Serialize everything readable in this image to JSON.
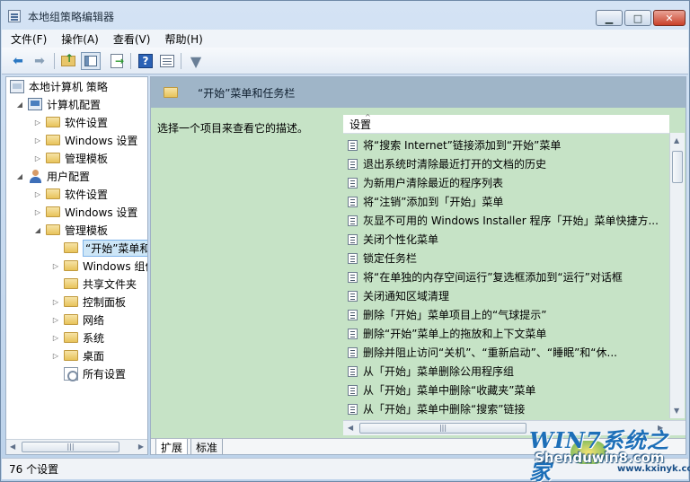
{
  "window": {
    "title": "本地组策略编辑器",
    "controls": {
      "minimize": "▁",
      "maximize": "□",
      "close": "✕"
    }
  },
  "menu": [
    "文件(F)",
    "操作(A)",
    "查看(V)",
    "帮助(H)"
  ],
  "toolbar": {
    "icons": [
      "back-arrow-icon",
      "forward-arrow-icon",
      "up-folder-icon",
      "show-hide-tree-icon",
      "export-list-icon",
      "help-icon",
      "properties-icon",
      "filter-icon"
    ],
    "back": "⬅",
    "forward": "➡",
    "help": "?",
    "filter": "▼"
  },
  "tree": {
    "root": "本地计算机 策略",
    "computer_config": "计算机配置",
    "cc_software": "软件设置",
    "cc_windows": "Windows 设置",
    "cc_admin": "管理模板",
    "user_config": "用户配置",
    "uc_software": "软件设置",
    "uc_windows": "Windows 设置",
    "uc_admin": "管理模板",
    "start_menu": "“开始”菜单和任务栏",
    "windows_components": "Windows 组件",
    "shared_folders": "共享文件夹",
    "control_panel": "控制面板",
    "network": "网络",
    "system": "系统",
    "desktop": "桌面",
    "all_settings": "所有设置",
    "scroll_thumb": "|||"
  },
  "right": {
    "header_title": "“开始”菜单和任务栏",
    "description": "选择一个项目来查看它的描述。",
    "column_header": "设置",
    "settings": [
      "将“搜索 Internet”链接添加到“开始”菜单",
      "退出系统时清除最近打开的文档的历史",
      "为新用户清除最近的程序列表",
      "将“注销”添加到「开始」菜单",
      "灰显不可用的 Windows Installer 程序「开始」菜单快捷方...",
      "关闭个性化菜单",
      "锁定任务栏",
      "将“在单独的内存空间运行”复选框添加到“运行”对话框",
      "关闭通知区域清理",
      "删除「开始」菜单项目上的“气球提示”",
      "删除“开始”菜单上的拖放和上下文菜单",
      "删除并阻止访问“关机”、“重新启动”、“睡眠”和“休...",
      "从「开始」菜单删除公用程序组",
      "从「开始」菜单中删除“收藏夹”菜单",
      "从「开始」菜单中删除“搜索”链接"
    ],
    "hscroll_thumb": "|||"
  },
  "tabs": [
    "扩展",
    "标准"
  ],
  "status": "76 个设置",
  "watermark": {
    "main": "WIN7系统之家",
    "sub": "Shenduwin8.com",
    "url": "www.kxinyk.com"
  }
}
